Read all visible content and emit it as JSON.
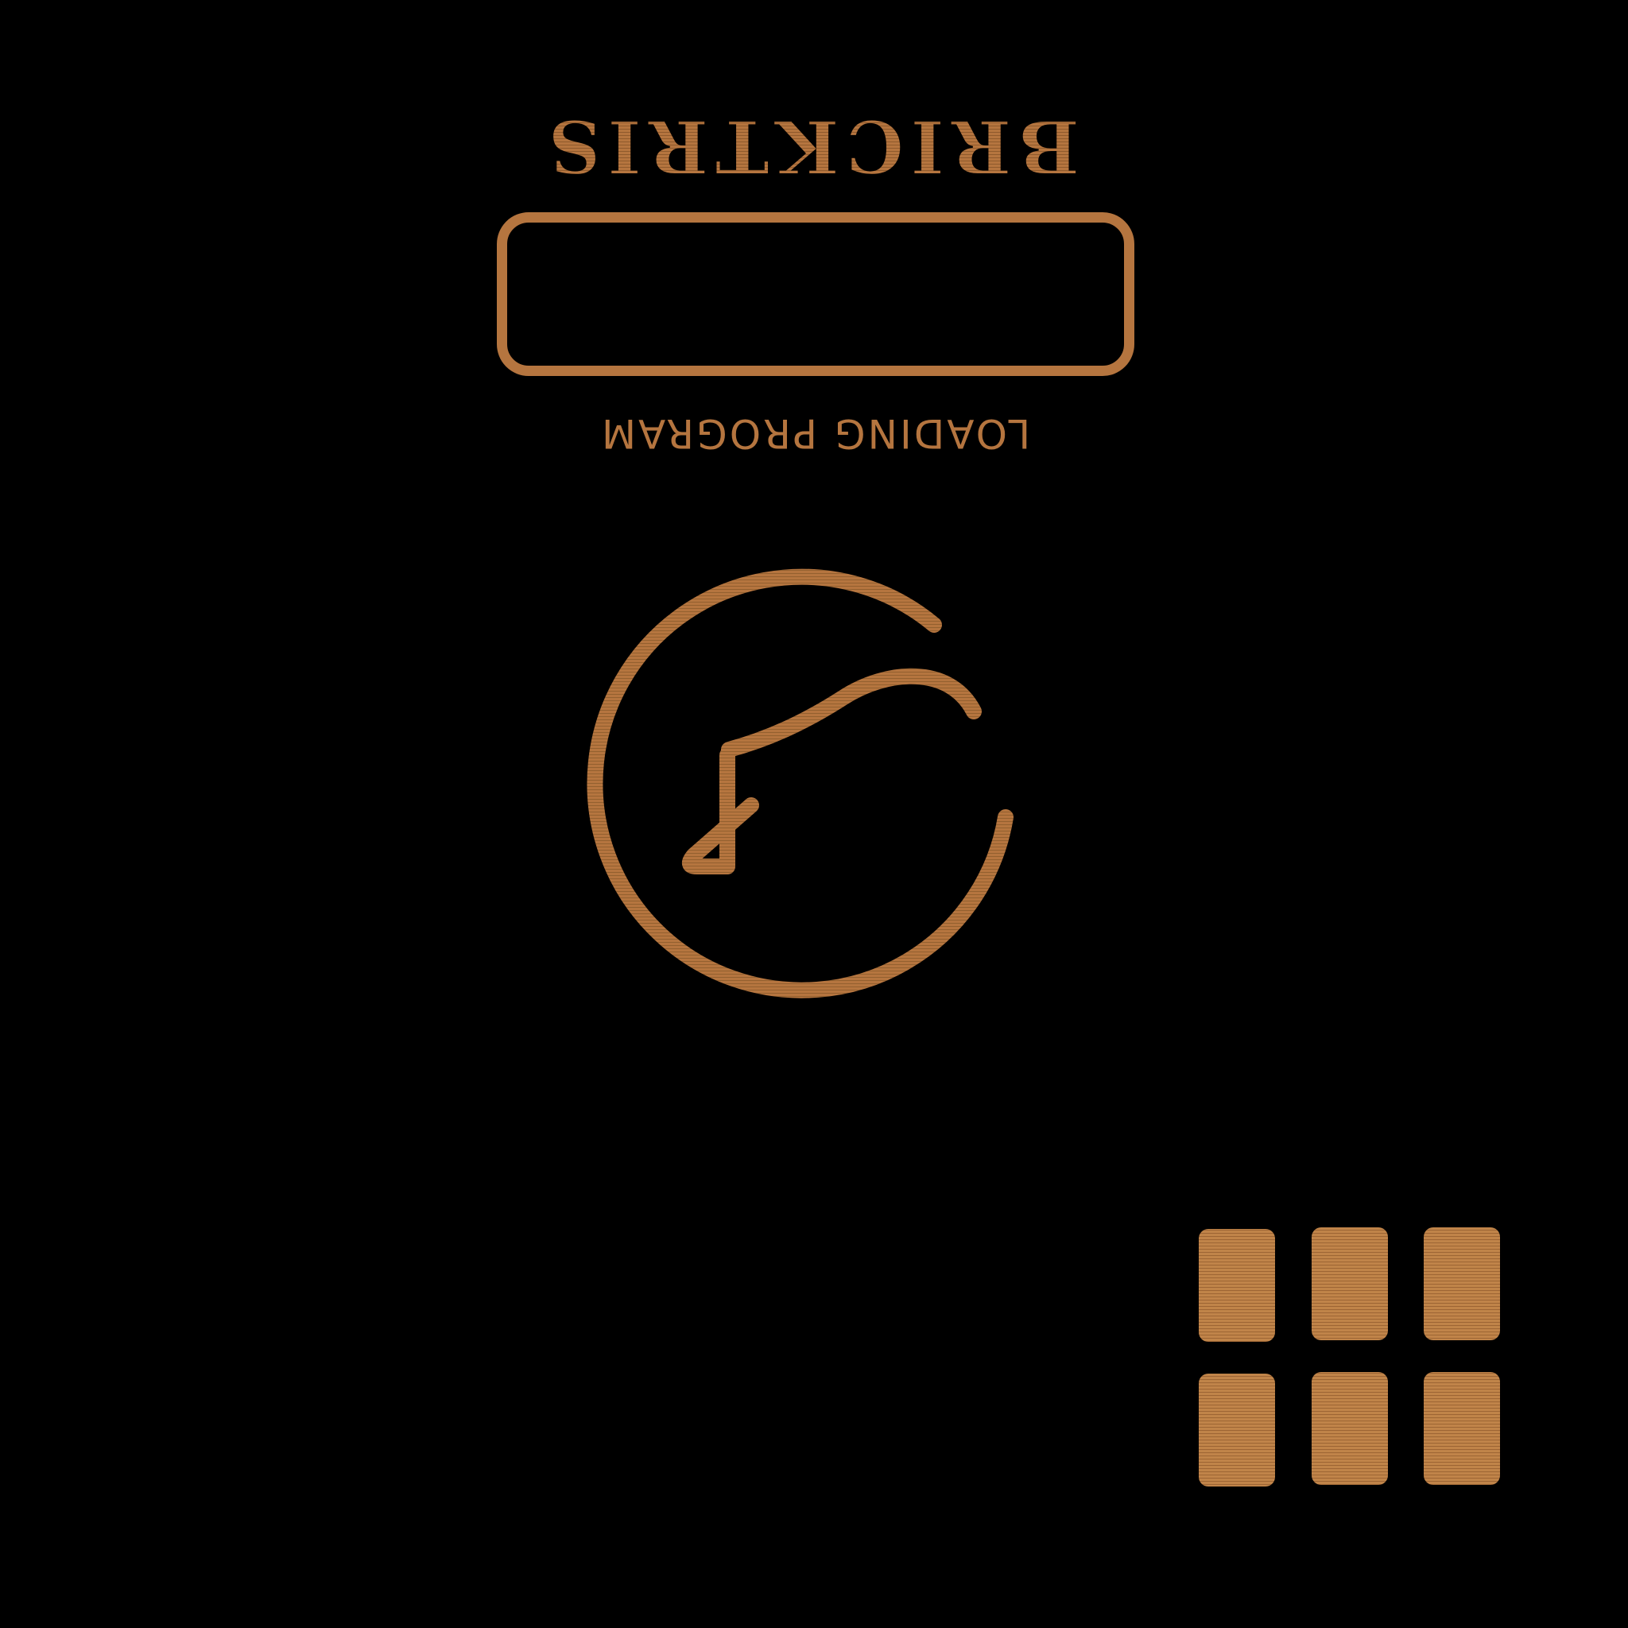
{
  "app": {
    "logo_text": "BRICKTRIS"
  },
  "loader": {
    "progress_percent": 0,
    "status_text": "LOADING PROGRAM"
  },
  "icons": {
    "spinner": "spinner-icon",
    "menu": "menu-grid-icon"
  },
  "colors": {
    "background": "#000000",
    "accent": "#b5753f"
  }
}
